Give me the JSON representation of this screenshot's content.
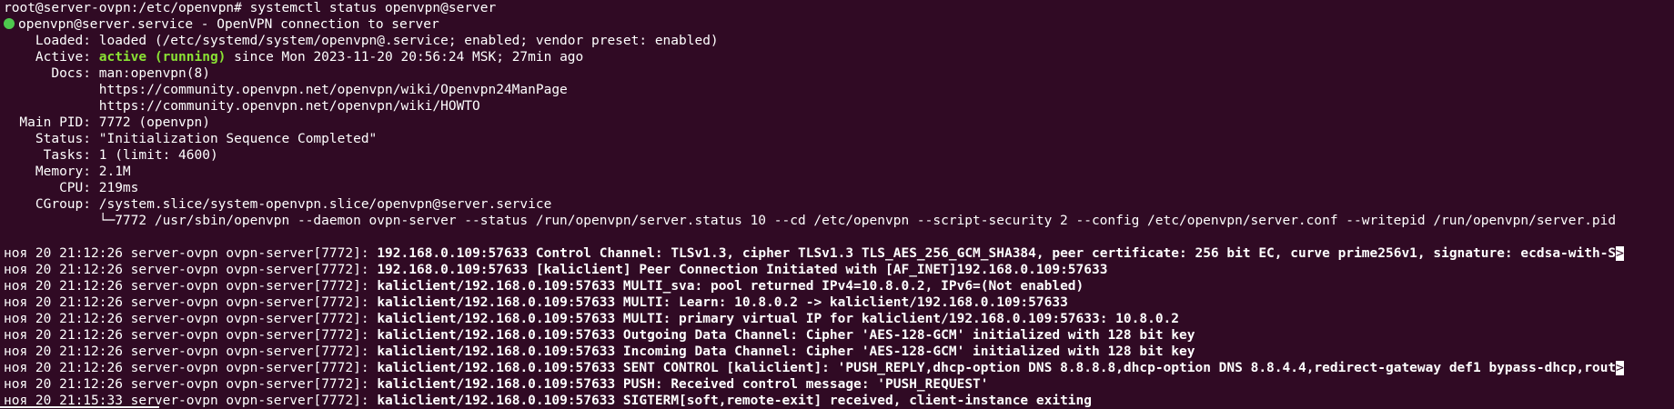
{
  "colors": {
    "background": "#300a24",
    "foreground": "#ffffff",
    "active_green": "#8ae234",
    "status_dot": "#4ec94e"
  },
  "prompt": {
    "text": "root@server-ovpn:/etc/openvpn# systemctl status openvpn@server"
  },
  "unit": {
    "header": "openvpn@server.service - OpenVPN connection to server",
    "loaded_label": "Loaded:",
    "loaded_value": "loaded (/etc/systemd/system/openvpn@.service; enabled; vendor preset: enabled)",
    "active_label": "Active:",
    "active_state": "active (running)",
    "active_rest": "since Mon 2023-11-20 20:56:24 MSK; 27min ago",
    "docs_label": "Docs:",
    "docs": [
      "man:openvpn(8)",
      "https://community.openvpn.net/openvpn/wiki/Openvpn24ManPage",
      "https://community.openvpn.net/openvpn/wiki/HOWTO"
    ],
    "main_pid_label": "Main PID:",
    "main_pid_value": "7772 (openvpn)",
    "status_label": "Status:",
    "status_value": "\"Initialization Sequence Completed\"",
    "tasks_label": "Tasks:",
    "tasks_value": "1 (limit: 4600)",
    "memory_label": "Memory:",
    "memory_value": "2.1M",
    "cpu_label": "CPU:",
    "cpu_value": "219ms",
    "cgroup_label": "CGroup:",
    "cgroup_value": "/system.slice/system-openvpn.slice/openvpn@server.service",
    "cgroup_process": "└─7772 /usr/sbin/openvpn --daemon ovpn-server --status /run/openvpn/server.status 10 --cd /etc/openvpn --script-security 2 --config /etc/openvpn/server.conf --writepid /run/openvpn/server.pid"
  },
  "journal": [
    {
      "prefix": "ноя 20 21:12:26 server-ovpn ovpn-server[7772]: ",
      "msg": "192.168.0.109:57633 Control Channel: TLSv1.3, cipher TLSv1.3 TLS_AES_256_GCM_SHA384, peer certificate: 256 bit EC, curve prime256v1, signature: ecdsa-with-S",
      "cut": ">"
    },
    {
      "prefix": "ноя 20 21:12:26 server-ovpn ovpn-server[7772]: ",
      "msg": "192.168.0.109:57633 [kaliclient] Peer Connection Initiated with [AF_INET]192.168.0.109:57633",
      "cut": ""
    },
    {
      "prefix": "ноя 20 21:12:26 server-ovpn ovpn-server[7772]: ",
      "msg": "kaliclient/192.168.0.109:57633 MULTI_sva: pool returned IPv4=10.8.0.2, IPv6=(Not enabled)",
      "cut": ""
    },
    {
      "prefix": "ноя 20 21:12:26 server-ovpn ovpn-server[7772]: ",
      "msg": "kaliclient/192.168.0.109:57633 MULTI: Learn: 10.8.0.2 -> kaliclient/192.168.0.109:57633",
      "cut": ""
    },
    {
      "prefix": "ноя 20 21:12:26 server-ovpn ovpn-server[7772]: ",
      "msg": "kaliclient/192.168.0.109:57633 MULTI: primary virtual IP for kaliclient/192.168.0.109:57633: 10.8.0.2",
      "cut": ""
    },
    {
      "prefix": "ноя 20 21:12:26 server-ovpn ovpn-server[7772]: ",
      "msg": "kaliclient/192.168.0.109:57633 Outgoing Data Channel: Cipher 'AES-128-GCM' initialized with 128 bit key",
      "cut": ""
    },
    {
      "prefix": "ноя 20 21:12:26 server-ovpn ovpn-server[7772]: ",
      "msg": "kaliclient/192.168.0.109:57633 Incoming Data Channel: Cipher 'AES-128-GCM' initialized with 128 bit key",
      "cut": ""
    },
    {
      "prefix": "ноя 20 21:12:26 server-ovpn ovpn-server[7772]: ",
      "msg": "kaliclient/192.168.0.109:57633 SENT CONTROL [kaliclient]: 'PUSH_REPLY,dhcp-option DNS 8.8.8.8,dhcp-option DNS 8.8.4.4,redirect-gateway def1 bypass-dhcp,rout",
      "cut": ">"
    },
    {
      "prefix": "ноя 20 21:12:26 server-ovpn ovpn-server[7772]: ",
      "msg": "kaliclient/192.168.0.109:57633 PUSH: Received control message: 'PUSH_REQUEST'",
      "cut": ""
    },
    {
      "prefix": "ноя 20 21:15:33 server-ovpn ovpn-server[7772]: ",
      "msg": "kaliclient/192.168.0.109:57633 SIGTERM[soft,remote-exit] received, client-instance exiting",
      "cut": ""
    }
  ]
}
